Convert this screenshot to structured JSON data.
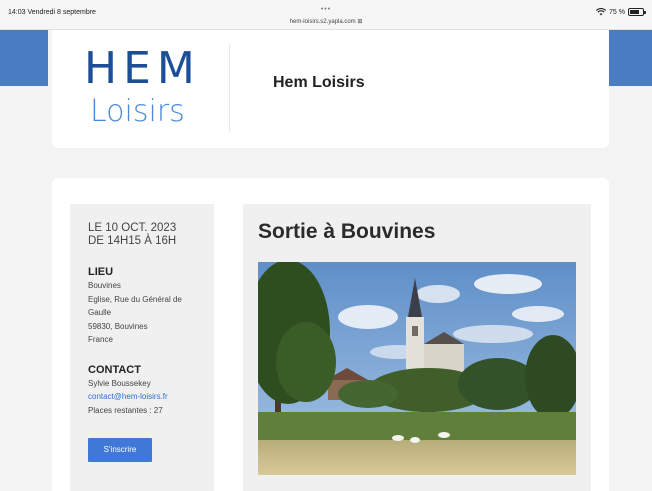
{
  "status_bar": {
    "time": "14:03  Vendredi 8 septembre",
    "dots": "•••",
    "url": "hem-loisirs.s2.yapla.com ⊞",
    "wifi_icon": "wifi-icon",
    "battery_text": "75 %",
    "battery_level": 0.75
  },
  "header": {
    "logo_line1": "HEM",
    "logo_line2": "Loisirs",
    "site_title": "Hem Loisirs"
  },
  "event": {
    "date_line1": "LE 10 OCT. 2023",
    "date_line2": "DE 14H15 À 16H",
    "location_heading": "LIEU",
    "location_lines": [
      "Bouvines",
      "Eglise, Rue du Général de",
      "Gaulle",
      "59830, Bouvines",
      "France"
    ],
    "contact_heading": "CONTACT",
    "contact_name": "Sylvie Boussekey",
    "contact_email": "contact@hem-loisirs.fr",
    "places_remaining": "Places restantes : 27",
    "register_label": "S'inscrire",
    "title": "Sortie à Bouvines"
  },
  "colors": {
    "brand_blue": "#4a7cc2",
    "button_blue": "#3f78d6",
    "link_blue": "#2a6fd1",
    "logo_dark_blue": "#1d4f99"
  }
}
